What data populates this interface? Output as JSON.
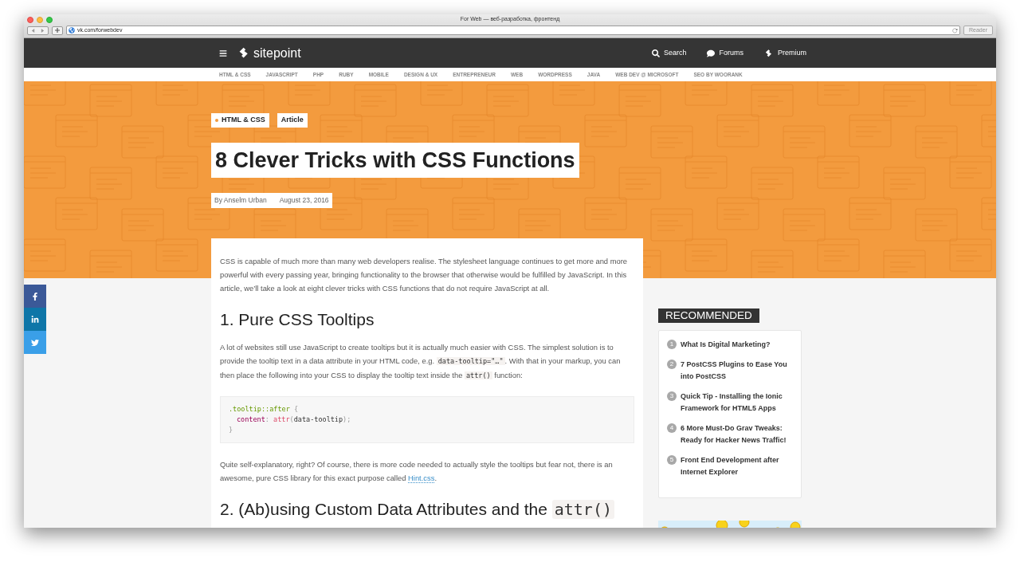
{
  "browser": {
    "title": "For Web — веб-разработка, фронтенд",
    "url": "vk.com/forwebdev",
    "reader_button": {
      "label": "Reader",
      "disabled": true
    }
  },
  "site_nav": {
    "logo_text": "sitepoint",
    "actions": [
      {
        "label": "Search",
        "kind": "search"
      },
      {
        "label": "Forums",
        "kind": "forums"
      },
      {
        "label": "Premium",
        "kind": "premium"
      }
    ]
  },
  "categories": [
    "HTML & CSS",
    "JAVASCRIPT",
    "PHP",
    "RUBY",
    "MOBILE",
    "DESIGN & UX",
    "ENTREPRENEUR",
    "WEB",
    "WORDPRESS",
    "JAVA",
    "WEB DEV @ MICROSOFT",
    "SEO BY WOORANK"
  ],
  "hero": {
    "tags": [
      {
        "label": "HTML & CSS",
        "kind": "topic"
      },
      {
        "label": "Article",
        "kind": "type"
      }
    ],
    "title": "8 Clever Tricks with CSS Functions",
    "author": "By Anselm Urban",
    "date": "August 23, 2016"
  },
  "social": [
    {
      "kind": "facebook"
    },
    {
      "kind": "linkedin"
    },
    {
      "kind": "twitter"
    }
  ],
  "article": [
    {
      "kind": "paragraph",
      "segments": [
        {
          "kind": "text",
          "text": "CSS is capable of much more than many web developers realise. The stylesheet language continues to get more and more powerful with every passing year, bringing functionality to the browser that otherwise would be fulfilled by JavaScript. In this article, we’ll take a look at eight clever tricks with CSS functions that do not require JavaScript at all."
        }
      ]
    },
    {
      "kind": "heading",
      "segments": [
        {
          "kind": "text",
          "text": "1. Pure CSS Tooltips"
        }
      ]
    },
    {
      "kind": "paragraph",
      "segments": [
        {
          "kind": "text",
          "text": "A lot of websites still use JavaScript to create tooltips but it is actually much easier with CSS. The simplest solution is to provide the tooltip text in a data attribute in your HTML code, e.g. "
        },
        {
          "kind": "code",
          "text": "data-tooltip=\"…\""
        },
        {
          "kind": "text",
          "text": ". With that in your markup, you can then place the following into your CSS to display the tooltip text inside the "
        },
        {
          "kind": "code",
          "text": "attr()"
        },
        {
          "kind": "text",
          "text": " function:"
        }
      ]
    },
    {
      "kind": "codeblock",
      "lines": [
        {
          "indented": false,
          "tokens": [
            {
              "kind": "selector",
              "text": ".tooltip::after"
            },
            {
              "kind": "punct",
              "text": " {"
            }
          ]
        },
        {
          "indented": true,
          "tokens": [
            {
              "kind": "property",
              "text": "content"
            },
            {
              "kind": "punct",
              "text": ": "
            },
            {
              "kind": "function",
              "text": "attr"
            },
            {
              "kind": "punct",
              "text": "("
            },
            {
              "kind": "plain",
              "text": "data-tooltip"
            },
            {
              "kind": "punct",
              "text": ");"
            }
          ]
        },
        {
          "indented": false,
          "tokens": [
            {
              "kind": "punct",
              "text": "}"
            }
          ]
        }
      ]
    },
    {
      "kind": "paragraph",
      "segments": [
        {
          "kind": "text",
          "text": "Quite self-explanatory, right? Of course, there is more code needed to actually style the tooltips but fear not, there is an awesome, pure CSS library for this exact purpose called "
        },
        {
          "kind": "link",
          "text": "Hint.css"
        },
        {
          "kind": "text",
          "text": "."
        }
      ]
    },
    {
      "kind": "heading",
      "segments": [
        {
          "kind": "text",
          "text": "2. (Ab)using Custom Data Attributes and the "
        },
        {
          "kind": "code",
          "text": "attr()"
        }
      ]
    }
  ],
  "sidebar": {
    "title": "RECOMMENDED",
    "items": [
      {
        "number": "1",
        "title": "What Is Digital Marketing?"
      },
      {
        "number": "2",
        "title": "7 PostCSS Plugins to Ease You into PostCSS"
      },
      {
        "number": "3",
        "title": "Quick Tip - Installing the Ionic Framework for HTML5 Apps"
      },
      {
        "number": "4",
        "title": "6 More Must-Do Grav Tweaks: Ready for Hacker News Traffic!"
      },
      {
        "number": "5",
        "title": "Front End Development after Internet Explorer"
      }
    ]
  }
}
